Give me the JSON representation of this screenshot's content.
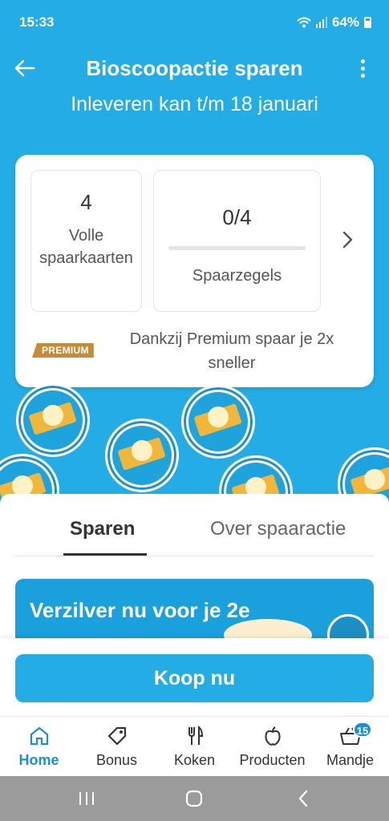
{
  "status_bar": {
    "time": "15:33",
    "battery": "64%"
  },
  "header": {
    "title": "Bioscoopactie sparen",
    "subtitle": "Inleveren kan t/m 18 januari"
  },
  "card": {
    "full_cards_value": "4",
    "full_cards_label": "Volle spaarkaarten",
    "stamps_value": "0/4",
    "stamps_label": "Spaarzegels",
    "stamps_progress": 0,
    "premium_badge": "PREMIUM",
    "premium_text": "Dankzij Premium spaar je 2x sneller"
  },
  "tabs": [
    {
      "label": "Sparen",
      "active": true
    },
    {
      "label": "Over spaaractie",
      "active": false
    }
  ],
  "promo": {
    "text": "Verzilver nu voor je 2e"
  },
  "buy_button": {
    "label": "Koop nu"
  },
  "bottom_nav": {
    "items": [
      {
        "label": "Home",
        "icon": "home-icon",
        "active": true
      },
      {
        "label": "Bonus",
        "icon": "tag-icon",
        "active": false
      },
      {
        "label": "Koken",
        "icon": "cutlery-icon",
        "active": false
      },
      {
        "label": "Producten",
        "icon": "apple-icon",
        "active": false
      },
      {
        "label": "Mandje",
        "icon": "basket-icon",
        "active": false,
        "badge": "15"
      }
    ]
  },
  "colors": {
    "brand": "#23ace6",
    "premium": "#c68b38",
    "active_nav": "#1d8fd0"
  }
}
